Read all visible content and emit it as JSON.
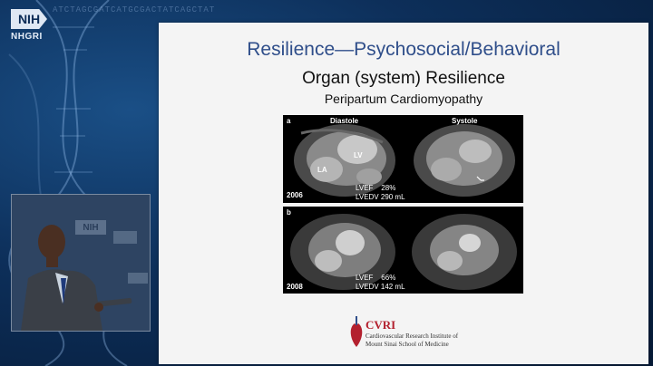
{
  "branding": {
    "logo_text": "NIH",
    "institute": "NHGRI",
    "dna_sequence": "ATCTAGCGATCATGCGACTATCAGCTAT"
  },
  "slide": {
    "title": "Resilience—Psychosocial/Behavioral",
    "subtitle": "Organ (system) Resilience",
    "subsubtitle": "Peripartum Cardiomyopathy",
    "panel_a": {
      "tag": "a",
      "left_header": "Diastole",
      "right_header": "Systole",
      "lv_label": "LV",
      "la_label": "LA",
      "year": "2006",
      "lvef": "LVEF    28%",
      "lvedv": "LVEDV 290 mL"
    },
    "panel_b": {
      "tag": "b",
      "year": "2008",
      "lvef": "LVEF    66%",
      "lvedv": "LVEDV 142 mL"
    },
    "footer_logo": {
      "name": "CVRI",
      "line1": "Cardiovascular Research Institute of",
      "line2": "Mount Sinai School of Medicine"
    }
  },
  "colors": {
    "title": "#2f4e8a",
    "background": "#0d2f5a",
    "logo_red": "#b3202e"
  },
  "speaker_video": {
    "backdrop_logo": "NIH"
  }
}
